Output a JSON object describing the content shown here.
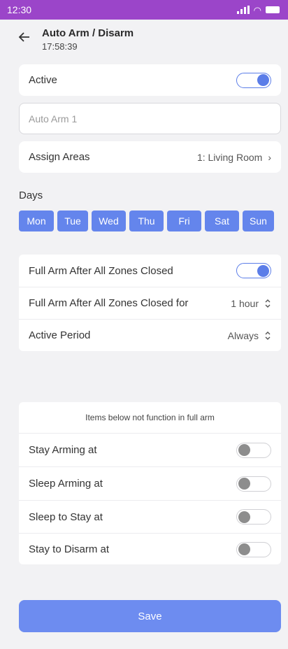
{
  "status": {
    "time": "12:30"
  },
  "header": {
    "title": "Auto Arm / Disarm",
    "subtitle": "17:58:39"
  },
  "active": {
    "label": "Active",
    "on": true
  },
  "name_field": {
    "placeholder": "Auto Arm 1"
  },
  "assign_areas": {
    "label": "Assign Areas",
    "value": "1: Living Room"
  },
  "days": {
    "label": "Days",
    "items": [
      "Mon",
      "Tue",
      "Wed",
      "Thu",
      "Fri",
      "Sat",
      "Sun"
    ]
  },
  "arm_settings": {
    "full_arm_closed": {
      "label": "Full Arm After All Zones Closed",
      "on": true
    },
    "full_arm_closed_for": {
      "label": "Full Arm After All Zones Closed for",
      "value": "1 hour"
    },
    "active_period": {
      "label": "Active Period",
      "value": "Always"
    }
  },
  "schedule": {
    "note": "Items below not function in full arm",
    "items": [
      {
        "label": "Stay Arming at",
        "on": false
      },
      {
        "label": "Sleep Arming at",
        "on": false
      },
      {
        "label": "Sleep to Stay at",
        "on": false
      },
      {
        "label": "Stay to Disarm at",
        "on": false
      }
    ]
  },
  "save_label": "Save",
  "colors": {
    "status_bar": "#9b45c9",
    "accent": "#6485ec",
    "save": "#6d8cf0"
  },
  "icons": [
    "back-arrow-icon",
    "chevron-right-icon",
    "updown-icon",
    "signal-icon",
    "wifi-icon",
    "battery-icon"
  ]
}
